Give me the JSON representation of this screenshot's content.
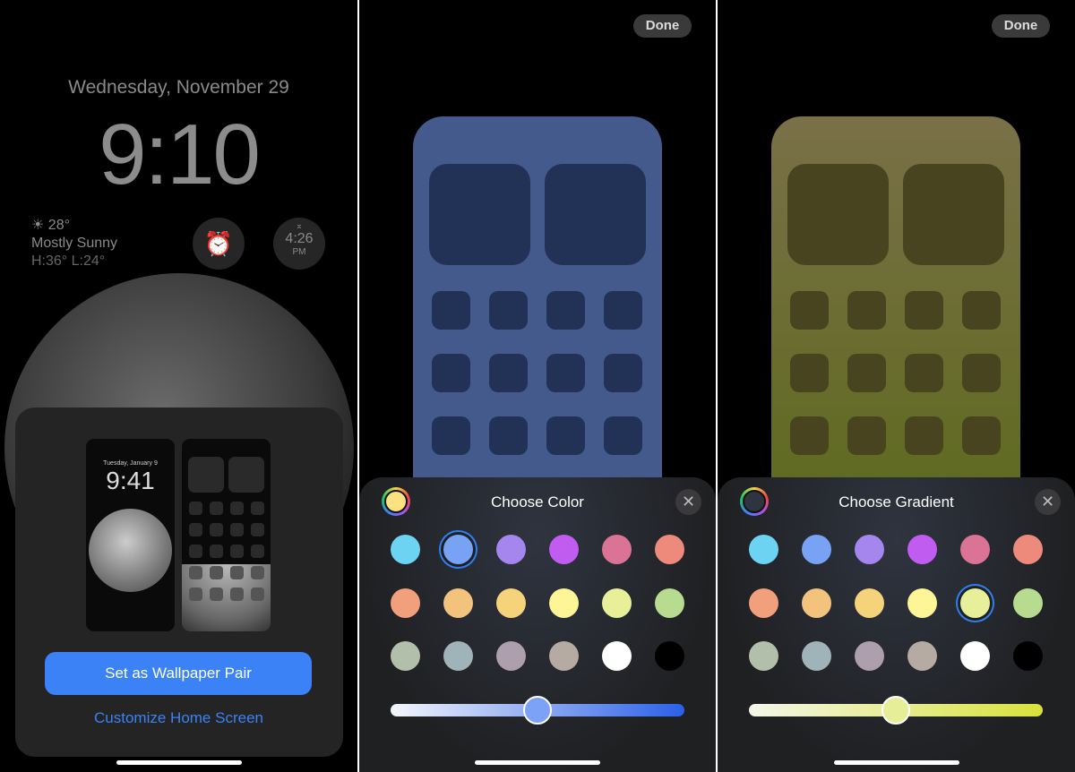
{
  "lock": {
    "date": "Wednesday, November 29",
    "time": "9:10",
    "weather": {
      "temp": "28°",
      "condition": "Mostly Sunny",
      "range": "H:36° L:24°"
    },
    "sunset": {
      "time": "4:26",
      "ampm": "PM"
    },
    "preview": {
      "date": "Tuesday, January 9",
      "time": "9:41"
    },
    "primary_button": "Set as Wallpaper Pair",
    "link": "Customize Home Screen"
  },
  "color_panel": {
    "done": "Done",
    "title": "Choose Color",
    "preview_color": "#445a8c",
    "tile_color": "#223256",
    "current": "#f9e27f",
    "selected_index": 1,
    "slider": {
      "value": 0.5,
      "from": "#f4f6fb",
      "to": "#2a5fe8",
      "thumb": "#7ba2f6"
    }
  },
  "gradient_panel": {
    "done": "Done",
    "title": "Choose Gradient",
    "preview_top": "#7a7048",
    "preview_bottom": "#5e6a1e",
    "tile_color": "#47441f",
    "current": "#2e3440",
    "selected_index": 10,
    "slider": {
      "value": 0.5,
      "from": "#f4f7ea",
      "to": "#d8e23a",
      "thumb": "#e6ee98"
    }
  },
  "swatches": [
    "#6cd3f3",
    "#78a2f4",
    "#a586ee",
    "#c05cf0",
    "#db7396",
    "#ee8a7c",
    "#f2a07c",
    "#f3c37e",
    "#f5d37a",
    "#fdf596",
    "#e7ef99",
    "#b7dc90",
    "#b2c0ab",
    "#9fb3b8",
    "#ad9fad",
    "#b5aba3",
    "#ffffff",
    "#000000"
  ]
}
